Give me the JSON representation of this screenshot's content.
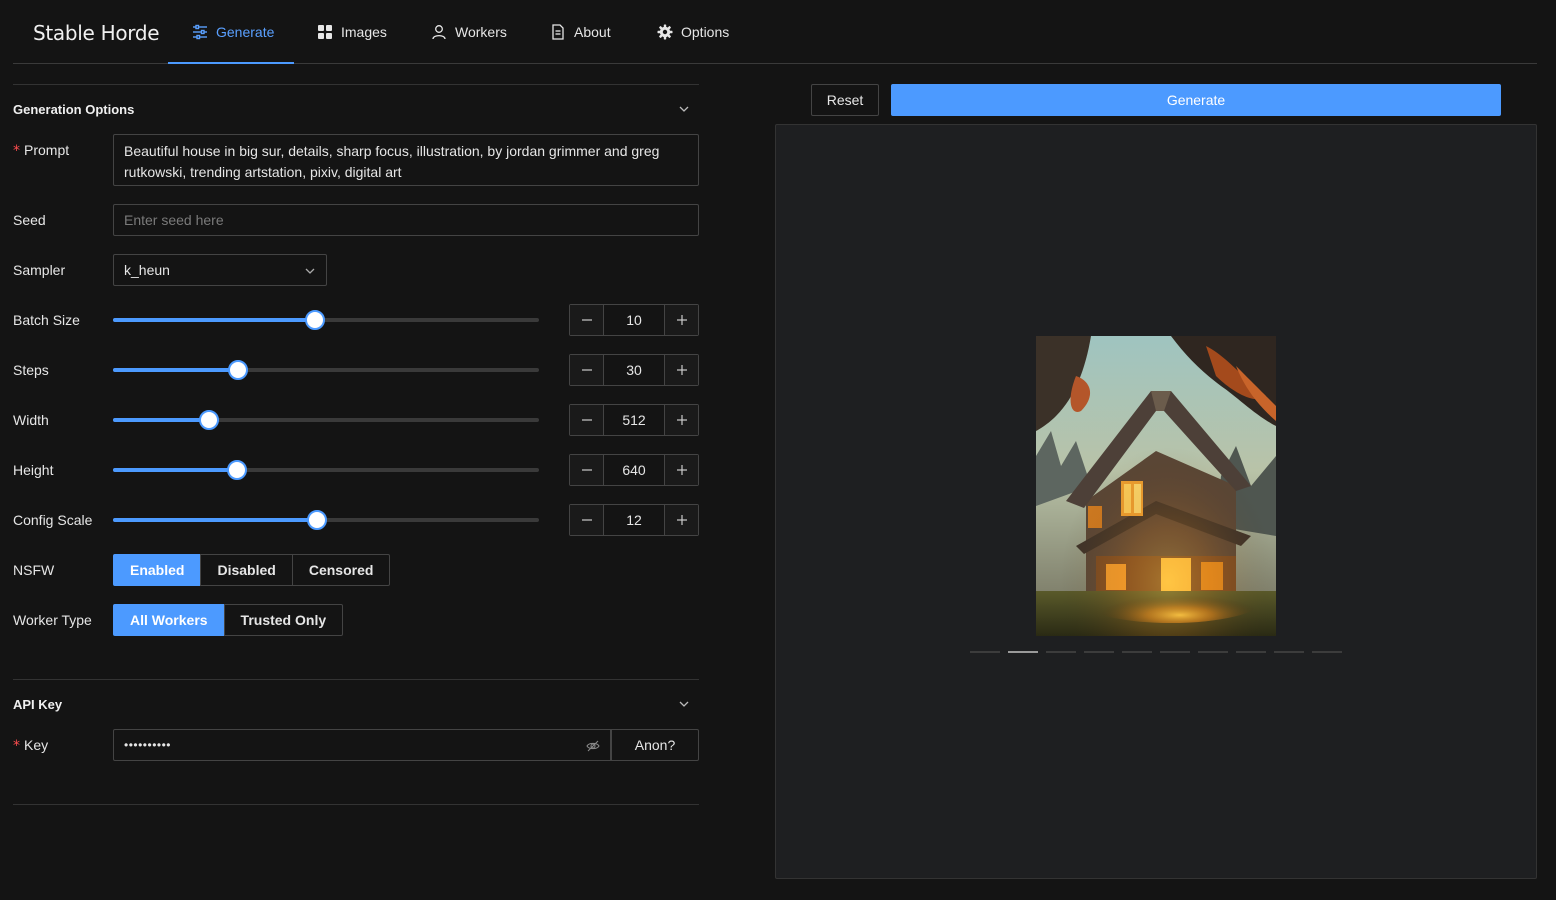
{
  "app": {
    "title": "Stable Horde"
  },
  "nav": {
    "items": [
      {
        "label": "Generate",
        "icon": "sliders-icon",
        "active": true
      },
      {
        "label": "Images",
        "icon": "grid-icon"
      },
      {
        "label": "Workers",
        "icon": "user-icon"
      },
      {
        "label": "About",
        "icon": "document-icon"
      },
      {
        "label": "Options",
        "icon": "gear-icon"
      }
    ]
  },
  "generation_options": {
    "title": "Generation Options",
    "prompt": {
      "label": "Prompt",
      "required_mark": "*",
      "value": "Beautiful house in big sur, details, sharp focus, illustration, by jordan grimmer and greg rutkowski, trending artstation, pixiv, digital art"
    },
    "seed": {
      "label": "Seed",
      "placeholder": "Enter seed here",
      "value": ""
    },
    "sampler": {
      "label": "Sampler",
      "value": "k_heun"
    },
    "batch_size": {
      "label": "Batch Size",
      "value": "10",
      "fraction": 0.474
    },
    "steps": {
      "label": "Steps",
      "value": "30",
      "fraction": 0.293
    },
    "width": {
      "label": "Width",
      "value": "512",
      "fraction": 0.225
    },
    "height": {
      "label": "Height",
      "value": "640",
      "fraction": 0.291
    },
    "config_scale": {
      "label": "Config Scale",
      "value": "12",
      "fraction": 0.479
    },
    "nsfw": {
      "label": "NSFW",
      "options": [
        "Enabled",
        "Disabled",
        "Censored"
      ],
      "selected": "Enabled"
    },
    "worker_type": {
      "label": "Worker Type",
      "options": [
        "All Workers",
        "Trusted Only"
      ],
      "selected": "All Workers"
    }
  },
  "api_key": {
    "title": "API Key",
    "key": {
      "label": "Key",
      "required_mark": "*",
      "value": "••••••••••"
    },
    "anon_label": "Anon?"
  },
  "actions": {
    "reset_label": "Reset",
    "generate_label": "Generate"
  },
  "gallery": {
    "image_count": 10,
    "current_index": 1
  },
  "colors": {
    "accent": "#4c9aff",
    "background": "#141414",
    "panel": "#1e1f21",
    "required": "#ff4d4f"
  }
}
